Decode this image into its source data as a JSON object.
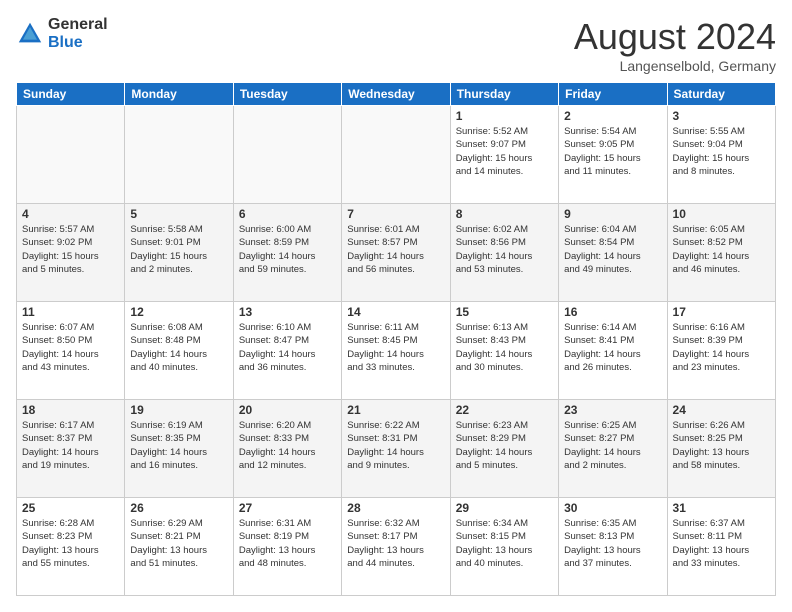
{
  "logo": {
    "general": "General",
    "blue": "Blue"
  },
  "header": {
    "month": "August 2024",
    "location": "Langenselbold, Germany"
  },
  "weekdays": [
    "Sunday",
    "Monday",
    "Tuesday",
    "Wednesday",
    "Thursday",
    "Friday",
    "Saturday"
  ],
  "weeks": [
    [
      {
        "day": "",
        "info": ""
      },
      {
        "day": "",
        "info": ""
      },
      {
        "day": "",
        "info": ""
      },
      {
        "day": "",
        "info": ""
      },
      {
        "day": "1",
        "info": "Sunrise: 5:52 AM\nSunset: 9:07 PM\nDaylight: 15 hours\nand 14 minutes."
      },
      {
        "day": "2",
        "info": "Sunrise: 5:54 AM\nSunset: 9:05 PM\nDaylight: 15 hours\nand 11 minutes."
      },
      {
        "day": "3",
        "info": "Sunrise: 5:55 AM\nSunset: 9:04 PM\nDaylight: 15 hours\nand 8 minutes."
      }
    ],
    [
      {
        "day": "4",
        "info": "Sunrise: 5:57 AM\nSunset: 9:02 PM\nDaylight: 15 hours\nand 5 minutes."
      },
      {
        "day": "5",
        "info": "Sunrise: 5:58 AM\nSunset: 9:01 PM\nDaylight: 15 hours\nand 2 minutes."
      },
      {
        "day": "6",
        "info": "Sunrise: 6:00 AM\nSunset: 8:59 PM\nDaylight: 14 hours\nand 59 minutes."
      },
      {
        "day": "7",
        "info": "Sunrise: 6:01 AM\nSunset: 8:57 PM\nDaylight: 14 hours\nand 56 minutes."
      },
      {
        "day": "8",
        "info": "Sunrise: 6:02 AM\nSunset: 8:56 PM\nDaylight: 14 hours\nand 53 minutes."
      },
      {
        "day": "9",
        "info": "Sunrise: 6:04 AM\nSunset: 8:54 PM\nDaylight: 14 hours\nand 49 minutes."
      },
      {
        "day": "10",
        "info": "Sunrise: 6:05 AM\nSunset: 8:52 PM\nDaylight: 14 hours\nand 46 minutes."
      }
    ],
    [
      {
        "day": "11",
        "info": "Sunrise: 6:07 AM\nSunset: 8:50 PM\nDaylight: 14 hours\nand 43 minutes."
      },
      {
        "day": "12",
        "info": "Sunrise: 6:08 AM\nSunset: 8:48 PM\nDaylight: 14 hours\nand 40 minutes."
      },
      {
        "day": "13",
        "info": "Sunrise: 6:10 AM\nSunset: 8:47 PM\nDaylight: 14 hours\nand 36 minutes."
      },
      {
        "day": "14",
        "info": "Sunrise: 6:11 AM\nSunset: 8:45 PM\nDaylight: 14 hours\nand 33 minutes."
      },
      {
        "day": "15",
        "info": "Sunrise: 6:13 AM\nSunset: 8:43 PM\nDaylight: 14 hours\nand 30 minutes."
      },
      {
        "day": "16",
        "info": "Sunrise: 6:14 AM\nSunset: 8:41 PM\nDaylight: 14 hours\nand 26 minutes."
      },
      {
        "day": "17",
        "info": "Sunrise: 6:16 AM\nSunset: 8:39 PM\nDaylight: 14 hours\nand 23 minutes."
      }
    ],
    [
      {
        "day": "18",
        "info": "Sunrise: 6:17 AM\nSunset: 8:37 PM\nDaylight: 14 hours\nand 19 minutes."
      },
      {
        "day": "19",
        "info": "Sunrise: 6:19 AM\nSunset: 8:35 PM\nDaylight: 14 hours\nand 16 minutes."
      },
      {
        "day": "20",
        "info": "Sunrise: 6:20 AM\nSunset: 8:33 PM\nDaylight: 14 hours\nand 12 minutes."
      },
      {
        "day": "21",
        "info": "Sunrise: 6:22 AM\nSunset: 8:31 PM\nDaylight: 14 hours\nand 9 minutes."
      },
      {
        "day": "22",
        "info": "Sunrise: 6:23 AM\nSunset: 8:29 PM\nDaylight: 14 hours\nand 5 minutes."
      },
      {
        "day": "23",
        "info": "Sunrise: 6:25 AM\nSunset: 8:27 PM\nDaylight: 14 hours\nand 2 minutes."
      },
      {
        "day": "24",
        "info": "Sunrise: 6:26 AM\nSunset: 8:25 PM\nDaylight: 13 hours\nand 58 minutes."
      }
    ],
    [
      {
        "day": "25",
        "info": "Sunrise: 6:28 AM\nSunset: 8:23 PM\nDaylight: 13 hours\nand 55 minutes."
      },
      {
        "day": "26",
        "info": "Sunrise: 6:29 AM\nSunset: 8:21 PM\nDaylight: 13 hours\nand 51 minutes."
      },
      {
        "day": "27",
        "info": "Sunrise: 6:31 AM\nSunset: 8:19 PM\nDaylight: 13 hours\nand 48 minutes."
      },
      {
        "day": "28",
        "info": "Sunrise: 6:32 AM\nSunset: 8:17 PM\nDaylight: 13 hours\nand 44 minutes."
      },
      {
        "day": "29",
        "info": "Sunrise: 6:34 AM\nSunset: 8:15 PM\nDaylight: 13 hours\nand 40 minutes."
      },
      {
        "day": "30",
        "info": "Sunrise: 6:35 AM\nSunset: 8:13 PM\nDaylight: 13 hours\nand 37 minutes."
      },
      {
        "day": "31",
        "info": "Sunrise: 6:37 AM\nSunset: 8:11 PM\nDaylight: 13 hours\nand 33 minutes."
      }
    ]
  ]
}
